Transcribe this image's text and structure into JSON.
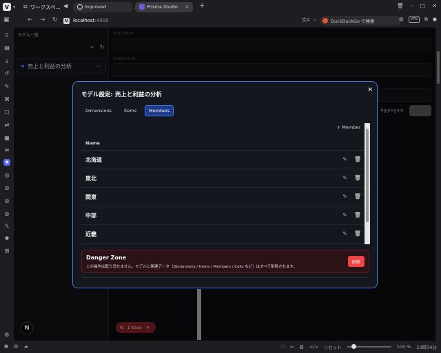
{
  "browser": {
    "workspace_label": "ワークスペ...",
    "tabs": [
      {
        "label": "Improved"
      },
      {
        "label": "Prisma Studio"
      }
    ],
    "url_host": "localhost",
    "url_port": ":4000",
    "search_placeholder": "DuckDuckGo で検索",
    "vpn": "VPN"
  },
  "models_panel": {
    "title": "モデル一覧",
    "add_icon": "plus",
    "refresh_icon": "refresh",
    "models": [
      {
        "label": "売上と利益の分析"
      }
    ]
  },
  "background": {
    "available_label": "AVAILABLE",
    "rows_label": "ROWS (0..N)",
    "aggregate_label": "Aggregate",
    "issue_count": "1 Issue"
  },
  "modal": {
    "title": "モデル設定: 売上と利益の分析",
    "tabs": [
      {
        "label": "Dimensions"
      },
      {
        "label": "Items"
      },
      {
        "label": "Members"
      }
    ],
    "active_tab": "Members",
    "add_member_label": "+ Member",
    "column_header": "Name",
    "members": [
      {
        "name": "北海道"
      },
      {
        "name": "東北"
      },
      {
        "name": "関東"
      },
      {
        "name": "中部"
      },
      {
        "name": "近畿"
      }
    ],
    "danger": {
      "title": "Danger Zone",
      "description": "この操作は取り消せません。モデルと関連データ（Dimensions / Items / Members / Cells など）はすべて削除されます。",
      "delete_label": "削除"
    }
  },
  "statusbar": {
    "reset_label": "リセット",
    "zoom": "100 %",
    "time": "23時34分"
  },
  "colors": {
    "accent": "#3b82f6",
    "danger": "#ef4444"
  }
}
